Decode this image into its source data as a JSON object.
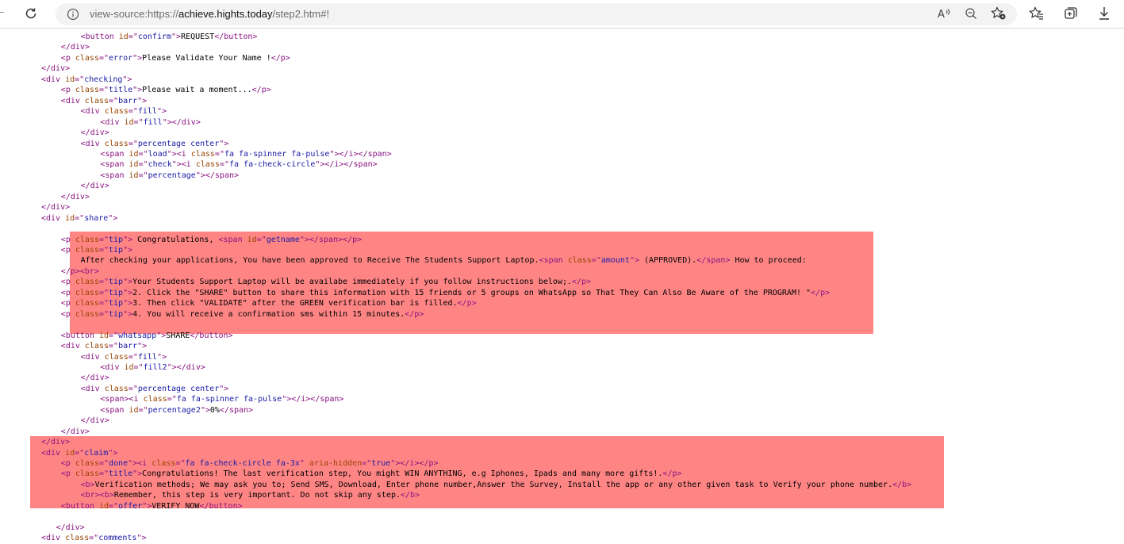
{
  "browser": {
    "address_bar": {
      "prefix": "view-source:https://",
      "domain": "achieve.hights.today",
      "path": "/step2.htm#!"
    },
    "icons": [
      "refresh-icon",
      "info-icon",
      "read-aloud-icon",
      "zoom-out-icon",
      "favorite-add-icon",
      "favorites-icon",
      "collections-icon",
      "downloads-icon"
    ]
  },
  "highlight_color": "#ff8585",
  "source_lines": [
    {
      "indent": 8,
      "segs": [
        [
          "t",
          "<button "
        ],
        [
          "a",
          "id"
        ],
        [
          "t",
          "=\""
        ],
        [
          "v",
          "confirm"
        ],
        [
          "t",
          "\">"
        ],
        [
          "x",
          "REQUEST"
        ],
        [
          "t",
          "</button>"
        ]
      ]
    },
    {
      "indent": 4,
      "segs": [
        [
          "t",
          "</div>"
        ]
      ]
    },
    {
      "indent": 4,
      "segs": [
        [
          "t",
          "<p "
        ],
        [
          "a",
          "class"
        ],
        [
          "t",
          "=\""
        ],
        [
          "v",
          "error"
        ],
        [
          "t",
          "\">"
        ],
        [
          "x",
          "Please Validate Your Name !"
        ],
        [
          "t",
          "</p>"
        ]
      ]
    },
    {
      "indent": 0,
      "segs": [
        [
          "t",
          "</div>"
        ]
      ]
    },
    {
      "indent": 0,
      "segs": [
        [
          "t",
          "<div "
        ],
        [
          "a",
          "id"
        ],
        [
          "t",
          "=\""
        ],
        [
          "v",
          "checking"
        ],
        [
          "t",
          "\">"
        ]
      ]
    },
    {
      "indent": 4,
      "segs": [
        [
          "t",
          "<p "
        ],
        [
          "a",
          "class"
        ],
        [
          "t",
          "=\""
        ],
        [
          "v",
          "title"
        ],
        [
          "t",
          "\">"
        ],
        [
          "x",
          "Please wait a moment..."
        ],
        [
          "t",
          "</p>"
        ]
      ]
    },
    {
      "indent": 4,
      "segs": [
        [
          "t",
          "<div "
        ],
        [
          "a",
          "class"
        ],
        [
          "t",
          "=\""
        ],
        [
          "v",
          "barr"
        ],
        [
          "t",
          "\">"
        ]
      ]
    },
    {
      "indent": 8,
      "segs": [
        [
          "t",
          "<div "
        ],
        [
          "a",
          "class"
        ],
        [
          "t",
          "=\""
        ],
        [
          "v",
          "fill"
        ],
        [
          "t",
          "\">"
        ]
      ]
    },
    {
      "indent": 12,
      "segs": [
        [
          "t",
          "<div "
        ],
        [
          "a",
          "id"
        ],
        [
          "t",
          "=\""
        ],
        [
          "v",
          "fill"
        ],
        [
          "t",
          "\"></div>"
        ]
      ]
    },
    {
      "indent": 8,
      "segs": [
        [
          "t",
          "</div>"
        ]
      ]
    },
    {
      "indent": 8,
      "segs": [
        [
          "t",
          "<div "
        ],
        [
          "a",
          "class"
        ],
        [
          "t",
          "=\""
        ],
        [
          "v",
          "percentage center"
        ],
        [
          "t",
          "\">"
        ]
      ]
    },
    {
      "indent": 12,
      "segs": [
        [
          "t",
          "<span "
        ],
        [
          "a",
          "id"
        ],
        [
          "t",
          "=\""
        ],
        [
          "v",
          "load"
        ],
        [
          "t",
          "\"><i "
        ],
        [
          "a",
          "class"
        ],
        [
          "t",
          "=\""
        ],
        [
          "v",
          "fa fa-spinner fa-pulse"
        ],
        [
          "t",
          "\"></i></span>"
        ]
      ]
    },
    {
      "indent": 12,
      "segs": [
        [
          "t",
          "<span "
        ],
        [
          "a",
          "id"
        ],
        [
          "t",
          "=\""
        ],
        [
          "v",
          "check"
        ],
        [
          "t",
          "\"><i "
        ],
        [
          "a",
          "class"
        ],
        [
          "t",
          "=\""
        ],
        [
          "v",
          "fa fa-check-circle"
        ],
        [
          "t",
          "\"></i></span>"
        ]
      ]
    },
    {
      "indent": 12,
      "segs": [
        [
          "t",
          "<span "
        ],
        [
          "a",
          "id"
        ],
        [
          "t",
          "=\""
        ],
        [
          "v",
          "percentage"
        ],
        [
          "t",
          "\"></span>"
        ]
      ]
    },
    {
      "indent": 8,
      "segs": [
        [
          "t",
          "</div>"
        ]
      ]
    },
    {
      "indent": 4,
      "segs": [
        [
          "t",
          "</div>"
        ]
      ]
    },
    {
      "indent": 0,
      "segs": [
        [
          "t",
          "</div>"
        ]
      ]
    },
    {
      "indent": 0,
      "segs": [
        [
          "t",
          "<div "
        ],
        [
          "a",
          "id"
        ],
        [
          "t",
          "=\""
        ],
        [
          "v",
          "share"
        ],
        [
          "t",
          "\">"
        ]
      ]
    },
    {
      "indent": 0,
      "segs": []
    },
    {
      "indent": 4,
      "segs": [
        [
          "t",
          "<p "
        ],
        [
          "a",
          "class"
        ],
        [
          "t",
          "=\""
        ],
        [
          "v",
          "tip"
        ],
        [
          "t",
          "\">"
        ],
        [
          "x",
          " Congratulations, "
        ],
        [
          "t",
          "<span "
        ],
        [
          "a",
          "id"
        ],
        [
          "t",
          "=\""
        ],
        [
          "v",
          "getname"
        ],
        [
          "t",
          "\"></span></p>"
        ]
      ]
    },
    {
      "indent": 4,
      "segs": [
        [
          "t",
          "<p "
        ],
        [
          "a",
          "class"
        ],
        [
          "t",
          "=\""
        ],
        [
          "v",
          "tip"
        ],
        [
          "t",
          "\">"
        ]
      ]
    },
    {
      "indent": 8,
      "segs": [
        [
          "x",
          "After checking your applications, You have been approved to Receive The Students Support Laptop."
        ],
        [
          "t",
          "<span "
        ],
        [
          "a",
          "class"
        ],
        [
          "t",
          "=\""
        ],
        [
          "v",
          "amount"
        ],
        [
          "t",
          "\">"
        ],
        [
          "x",
          " (APPROVED)."
        ],
        [
          "t",
          "</span>"
        ],
        [
          "x",
          " How to proceed:"
        ]
      ]
    },
    {
      "indent": 4,
      "segs": [
        [
          "t",
          "</p><br>"
        ]
      ]
    },
    {
      "indent": 4,
      "segs": [
        [
          "t",
          "<p "
        ],
        [
          "a",
          "class"
        ],
        [
          "t",
          "=\""
        ],
        [
          "v",
          "tip"
        ],
        [
          "t",
          "\">"
        ],
        [
          "x",
          "Your Students Support Laptop will be availabe immediately if you follow instructions below;."
        ],
        [
          "t",
          "</p>"
        ]
      ]
    },
    {
      "indent": 4,
      "segs": [
        [
          "t",
          "<p "
        ],
        [
          "a",
          "class"
        ],
        [
          "t",
          "=\""
        ],
        [
          "v",
          "tip"
        ],
        [
          "t",
          "\">"
        ],
        [
          "x",
          "2. Click the \"SHARE\" button to share this information with 15 friends or 5 groups on WhatsApp so That They Can Also Be Aware of the PROGRAM! \""
        ],
        [
          "t",
          "</p>"
        ]
      ]
    },
    {
      "indent": 4,
      "segs": [
        [
          "t",
          "<p "
        ],
        [
          "a",
          "class"
        ],
        [
          "t",
          "=\""
        ],
        [
          "v",
          "tip"
        ],
        [
          "t",
          "\">"
        ],
        [
          "x",
          "3. Then click \"VALIDATE\" after the GREEN verification bar is filled."
        ],
        [
          "t",
          "</p>"
        ]
      ]
    },
    {
      "indent": 4,
      "segs": [
        [
          "t",
          "<p "
        ],
        [
          "a",
          "class"
        ],
        [
          "t",
          "=\""
        ],
        [
          "v",
          "tip"
        ],
        [
          "t",
          "\">"
        ],
        [
          "x",
          "4. You will receive a confirmation sms within 15 minutes."
        ],
        [
          "t",
          "</p>"
        ]
      ]
    },
    {
      "indent": 0,
      "segs": []
    },
    {
      "indent": 4,
      "segs": [
        [
          "t",
          "<button "
        ],
        [
          "a",
          "id"
        ],
        [
          "t",
          "=\""
        ],
        [
          "v",
          "whatsapp"
        ],
        [
          "t",
          "\">"
        ],
        [
          "x",
          "SHARE"
        ],
        [
          "t",
          "</button>"
        ]
      ]
    },
    {
      "indent": 4,
      "segs": [
        [
          "t",
          "<div "
        ],
        [
          "a",
          "class"
        ],
        [
          "t",
          "=\""
        ],
        [
          "v",
          "barr"
        ],
        [
          "t",
          "\">"
        ]
      ]
    },
    {
      "indent": 8,
      "segs": [
        [
          "t",
          "<div "
        ],
        [
          "a",
          "class"
        ],
        [
          "t",
          "=\""
        ],
        [
          "v",
          "fill"
        ],
        [
          "t",
          "\">"
        ]
      ]
    },
    {
      "indent": 12,
      "segs": [
        [
          "t",
          "<div "
        ],
        [
          "a",
          "id"
        ],
        [
          "t",
          "=\""
        ],
        [
          "v",
          "fill2"
        ],
        [
          "t",
          "\"></div>"
        ]
      ]
    },
    {
      "indent": 8,
      "segs": [
        [
          "t",
          "</div>"
        ]
      ]
    },
    {
      "indent": 8,
      "segs": [
        [
          "t",
          "<div "
        ],
        [
          "a",
          "class"
        ],
        [
          "t",
          "=\""
        ],
        [
          "v",
          "percentage center"
        ],
        [
          "t",
          "\">"
        ]
      ]
    },
    {
      "indent": 12,
      "segs": [
        [
          "t",
          "<span><i "
        ],
        [
          "a",
          "class"
        ],
        [
          "t",
          "=\""
        ],
        [
          "v",
          "fa fa-spinner fa-pulse"
        ],
        [
          "t",
          "\"></i></span>"
        ]
      ]
    },
    {
      "indent": 12,
      "segs": [
        [
          "t",
          "<span "
        ],
        [
          "a",
          "id"
        ],
        [
          "t",
          "=\""
        ],
        [
          "v",
          "percentage2"
        ],
        [
          "t",
          "\">"
        ],
        [
          "x",
          "0%"
        ],
        [
          "t",
          "</span>"
        ]
      ]
    },
    {
      "indent": 8,
      "segs": [
        [
          "t",
          "</div>"
        ]
      ]
    },
    {
      "indent": 4,
      "segs": [
        [
          "t",
          "</div>"
        ]
      ]
    },
    {
      "indent": 0,
      "segs": [
        [
          "t",
          "</div>"
        ]
      ]
    },
    {
      "indent": 0,
      "segs": [
        [
          "t",
          "<div "
        ],
        [
          "a",
          "id"
        ],
        [
          "t",
          "=\""
        ],
        [
          "v",
          "claim"
        ],
        [
          "t",
          "\">"
        ]
      ]
    },
    {
      "indent": 4,
      "segs": [
        [
          "t",
          "<p "
        ],
        [
          "a",
          "class"
        ],
        [
          "t",
          "=\""
        ],
        [
          "v",
          "done"
        ],
        [
          "t",
          "\"><i "
        ],
        [
          "a",
          "class"
        ],
        [
          "t",
          "=\""
        ],
        [
          "v",
          "fa fa-check-circle fa-3x"
        ],
        [
          "t",
          "\" "
        ],
        [
          "a",
          "aria-hidden"
        ],
        [
          "t",
          "=\""
        ],
        [
          "v",
          "true"
        ],
        [
          "t",
          "\"></i></p>"
        ]
      ]
    },
    {
      "indent": 4,
      "segs": [
        [
          "t",
          "<p "
        ],
        [
          "a",
          "class"
        ],
        [
          "t",
          "=\""
        ],
        [
          "v",
          "title"
        ],
        [
          "t",
          "\">"
        ],
        [
          "x",
          "Congratulations! The last verification step, You might WIN ANYTHING, e.g Iphones, Ipads and many more gifts!."
        ],
        [
          "t",
          "</p>"
        ]
      ]
    },
    {
      "indent": 8,
      "segs": [
        [
          "t",
          "<b>"
        ],
        [
          "x",
          "Verification methods; We may ask you to; Send SMS, Download, Enter phone number,Answer the Survey, Install the app or any other given task to Verify your phone number."
        ],
        [
          "t",
          "</b>"
        ]
      ]
    },
    {
      "indent": 8,
      "segs": [
        [
          "t",
          "<br><b>"
        ],
        [
          "x",
          "Remember, this step is very important. Do not skip any step."
        ],
        [
          "t",
          "</b>"
        ]
      ]
    },
    {
      "indent": 4,
      "segs": [
        [
          "t",
          "<button "
        ],
        [
          "a",
          "id"
        ],
        [
          "t",
          "=\""
        ],
        [
          "v",
          "offer"
        ],
        [
          "t",
          "\">"
        ],
        [
          "x",
          "VERIFY NOW"
        ],
        [
          "t",
          "</button>"
        ]
      ]
    },
    {
      "indent": 0,
      "segs": []
    },
    {
      "indent": 3,
      "segs": [
        [
          "t",
          "</div>"
        ]
      ]
    },
    {
      "indent": 0,
      "segs": [
        [
          "t",
          "<div "
        ],
        [
          "a",
          "class"
        ],
        [
          "t",
          "=\""
        ],
        [
          "v",
          "comments"
        ],
        [
          "t",
          "\">"
        ]
      ]
    }
  ]
}
